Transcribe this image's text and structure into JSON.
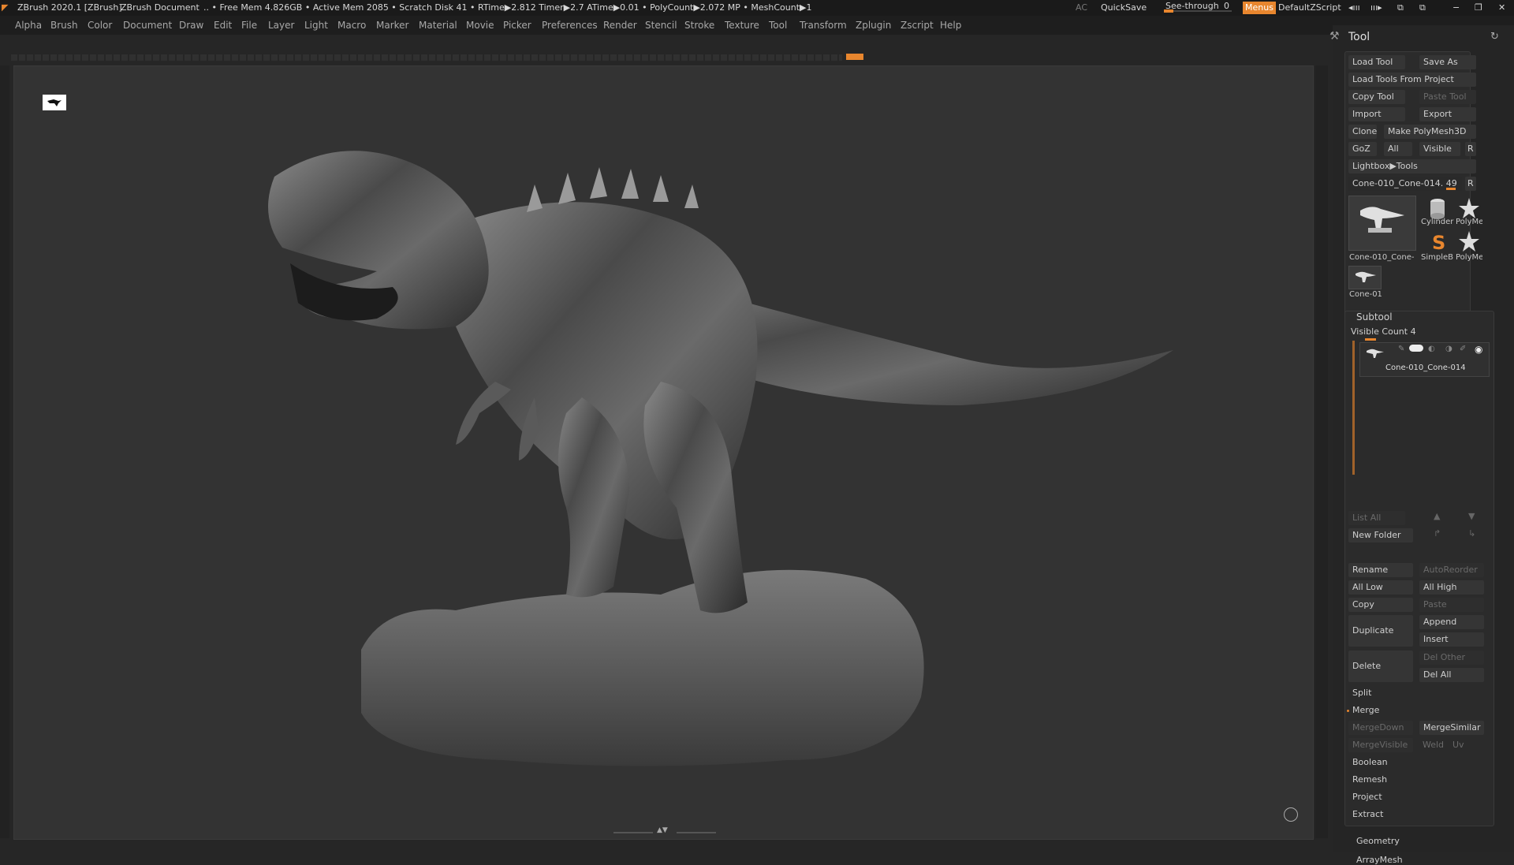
{
  "titlebar": {
    "app": "ZBrush 2020.1 [ZBrush]",
    "document": "ZBrush Document",
    "stats": ".. • Free Mem 4.826GB • Active Mem 2085 • Scratch Disk 41 •  RTime▶2.812 Timer▶2.7 ATime▶0.01 • PolyCount▶2.072 MP  • MeshCount▶1",
    "ac": "AC",
    "quicksave": "QuickSave",
    "seethrough": "See-through",
    "seethrough_value": "0",
    "menus": "Menus",
    "script": "DefaultZScript"
  },
  "menubar": {
    "items": [
      "Alpha",
      "Brush",
      "Color",
      "Document",
      "Draw",
      "Edit",
      "File",
      "Layer",
      "Light",
      "Macro",
      "Marker",
      "Material",
      "Movie",
      "Picker",
      "Preferences",
      "Render",
      "Stencil",
      "Stroke",
      "Texture",
      "Tool",
      "Transform",
      "Zplugin",
      "Zscript",
      "Help"
    ]
  },
  "panel": {
    "title": "Tool",
    "load_tool": "Load Tool",
    "save_as": "Save As",
    "load_from_project": "Load Tools From Project",
    "copy_tool": "Copy Tool",
    "paste_tool": "Paste Tool",
    "import": "Import",
    "export": "Export",
    "clone": "Clone",
    "make_polymesh": "Make PolyMesh3D",
    "goz": "GoZ",
    "all": "All",
    "visible": "Visible",
    "r": "R",
    "lightbox_tools": "Lightbox▶Tools",
    "current_tool": "Cone-010_Cone-014. 49",
    "thumbs": [
      {
        "label": "Cone-010_Cone-"
      },
      {
        "label": "Cylinder"
      },
      {
        "label": "PolyMes"
      },
      {
        "label": "SimpleB"
      },
      {
        "label": "PolyMes"
      },
      {
        "label": "Cone-01"
      }
    ],
    "subtool": {
      "header": "Subtool",
      "visible_count": "Visible Count 4",
      "item_name": "Cone-010_Cone-014",
      "list_all": "List All",
      "new_folder": "New Folder",
      "rename": "Rename",
      "autoreorder": "AutoReorder",
      "all_low": "All Low",
      "all_high": "All High",
      "copy": "Copy",
      "paste": "Paste",
      "duplicate": "Duplicate",
      "append": "Append",
      "insert": "Insert",
      "delete": "Delete",
      "del_other": "Del Other",
      "del_all": "Del All",
      "split": "Split",
      "merge": "Merge",
      "merge_down": "MergeDown",
      "merge_similar": "MergeSimilar",
      "merge_visible": "MergeVisible",
      "weld": "Weld",
      "uv": "Uv",
      "boolean": "Boolean",
      "remesh": "Remesh",
      "project": "Project",
      "extract": "Extract"
    },
    "geometry": "Geometry",
    "arraymesh": "ArrayMesh"
  },
  "colors": {
    "accent": "#e8862e",
    "background": "#262626",
    "viewport": "#333333"
  }
}
